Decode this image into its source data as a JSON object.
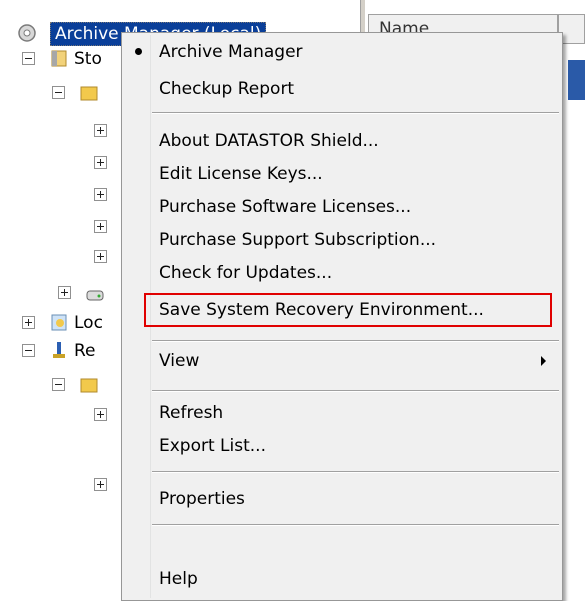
{
  "tree": {
    "root_label": "Archive Manager (Local)",
    "nodes": [
      {
        "label": "Sto"
      },
      {
        "label": "Loc"
      },
      {
        "label": "Re"
      }
    ]
  },
  "list": {
    "column_header": "Name"
  },
  "context_menu": {
    "items": [
      {
        "label": "Archive Manager",
        "checked": true
      },
      {
        "label": "Checkup Report"
      },
      {
        "label": "About DATASTOR Shield..."
      },
      {
        "label": "Edit License Keys..."
      },
      {
        "label": "Purchase Software Licenses..."
      },
      {
        "label": "Purchase Support Subscription..."
      },
      {
        "label": "Check for Updates..."
      },
      {
        "label": "Save System Recovery Environment...",
        "highlighted": true
      },
      {
        "label": "View",
        "submenu": true
      },
      {
        "label": "Refresh"
      },
      {
        "label": "Export List..."
      },
      {
        "label": "Properties"
      },
      {
        "label": "Help"
      }
    ],
    "highlight_color": "#e00000"
  },
  "colors": {
    "selection": "#0a3f99",
    "menu_bg": "#f0f0f0"
  }
}
